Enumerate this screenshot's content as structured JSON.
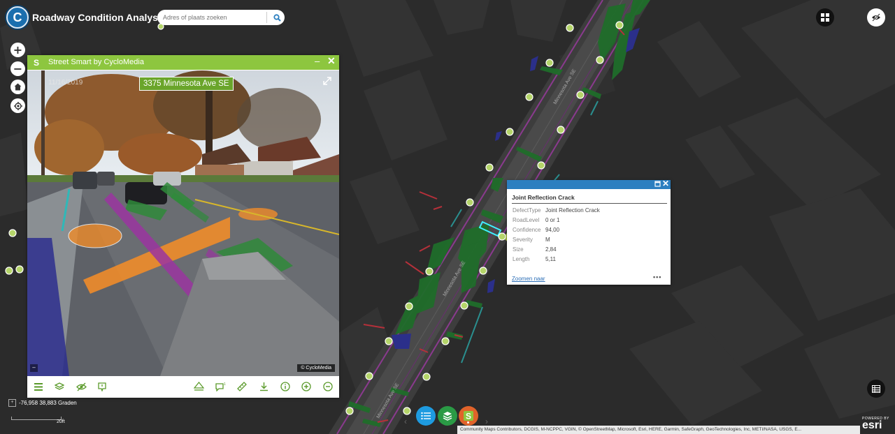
{
  "app": {
    "title": "Roadway Condition Analysis",
    "logo_letter": "C"
  },
  "search": {
    "placeholder": "Adres of plaats zoeken"
  },
  "map": {
    "street_labels": [
      "Minnesota Ave SE",
      "Minnesota Ave SE",
      "Minnesota Ave SE"
    ]
  },
  "street_smart": {
    "logo": "S",
    "title": "Street Smart by CycloMedia",
    "date": "11/16/2019",
    "address": "3375 Minnesota Ave SE",
    "copyright": "© CycloMedia",
    "toolbar": [
      "menu-icon",
      "layers-icon",
      "visibility-off-icon",
      "report-icon",
      "measure-height-icon",
      "comment-icon",
      "ruler-icon",
      "download-icon",
      "info-icon",
      "zoom-in-icon",
      "zoom-out-icon"
    ]
  },
  "popup": {
    "title": "Joint Reflection Crack",
    "attributes": [
      {
        "key": "DefectType",
        "value": "Joint Reflection Crack"
      },
      {
        "key": "RoadLevel",
        "value": "0 or 1"
      },
      {
        "key": "Confidence",
        "value": "94,00"
      },
      {
        "key": "Severity",
        "value": "M"
      },
      {
        "key": "Size",
        "value": "2,84"
      },
      {
        "key": "Length",
        "value": "5,11"
      }
    ],
    "zoom_link": "Zoomen naar",
    "more": "•••"
  },
  "coordinates": "-76,958 38,883 Graden",
  "scale": "20ft",
  "attribution": "Community Maps Contributors, DCGIS, M-NCPPC, VGIN, © OpenStreetMap, Microsoft, Esri, HERE, Garmin, SafeGraph, GeoTechnologies, Inc, METI/NASA, USGS, E...",
  "esri": {
    "powered": "POWERED BY",
    "word": "esri"
  },
  "colors": {
    "header_green": "#8dc63f",
    "popup_blue": "#2c7fc0",
    "map_bg": "#2b2b2b",
    "point_green": "#b5d56a"
  }
}
